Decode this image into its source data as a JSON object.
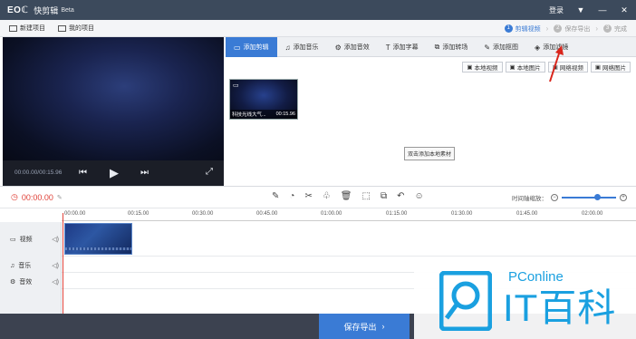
{
  "titlebar": {
    "logo": "EOℂ",
    "app_name": "快剪辑",
    "beta": "Beta",
    "login": "登录",
    "menu_icon": "down-triangle-icon",
    "minimize_icon": "minimize-icon",
    "close_icon": "close-icon"
  },
  "menubar": {
    "new_project": "新建项目",
    "my_projects": "我的项目",
    "steps": [
      {
        "num": "1",
        "label": "剪辑视频",
        "active": true
      },
      {
        "num": "2",
        "label": "保存导出",
        "active": false
      },
      {
        "num": "3",
        "label": "完成",
        "active": false
      }
    ]
  },
  "preview": {
    "time": "00:00.00/00:15.96"
  },
  "tabs": [
    {
      "label": "添加剪辑",
      "icon": "video-icon",
      "active": true
    },
    {
      "label": "添加音乐",
      "icon": "music-icon",
      "active": false
    },
    {
      "label": "添加音效",
      "icon": "sound-effect-icon",
      "active": false
    },
    {
      "label": "添加字幕",
      "icon": "text-icon",
      "active": false
    },
    {
      "label": "添加转场",
      "icon": "transition-icon",
      "active": false
    },
    {
      "label": "添加抠图",
      "icon": "cutout-icon",
      "active": false
    },
    {
      "label": "添加滤镜",
      "icon": "filter-icon",
      "active": false
    }
  ],
  "media_buttons": [
    "本地视频",
    "本地图片",
    "网络视频",
    "网络图片"
  ],
  "clip": {
    "title": "科技光线大气...",
    "duration": "00:15.96"
  },
  "hint": "双击添加本地素材",
  "timeline": {
    "current_time": "00:00.00",
    "zoom_label": "时间轴缩放：",
    "zoom_level": 0.6,
    "ruler": [
      "00:00.00",
      "00:15.00",
      "00:30.00",
      "00:45.00",
      "01:00.00",
      "01:15.00",
      "01:30.00",
      "01:45.00",
      "02:00.00"
    ],
    "tracks": [
      {
        "label": "视频",
        "icon": "video-track-icon"
      },
      {
        "label": "音乐",
        "icon": "music-note-icon"
      },
      {
        "label": "音效",
        "icon": "sound-effect-icon"
      }
    ]
  },
  "export": {
    "label": "保存导出",
    "arrow": "›"
  },
  "watermark": {
    "brand": "PConline",
    "title": "IT百科"
  },
  "colors": {
    "accent": "#3a7bd5",
    "titlebar": "#3c4a5c",
    "timecode": "#e0433a",
    "watermark": "#1aa0e0"
  }
}
